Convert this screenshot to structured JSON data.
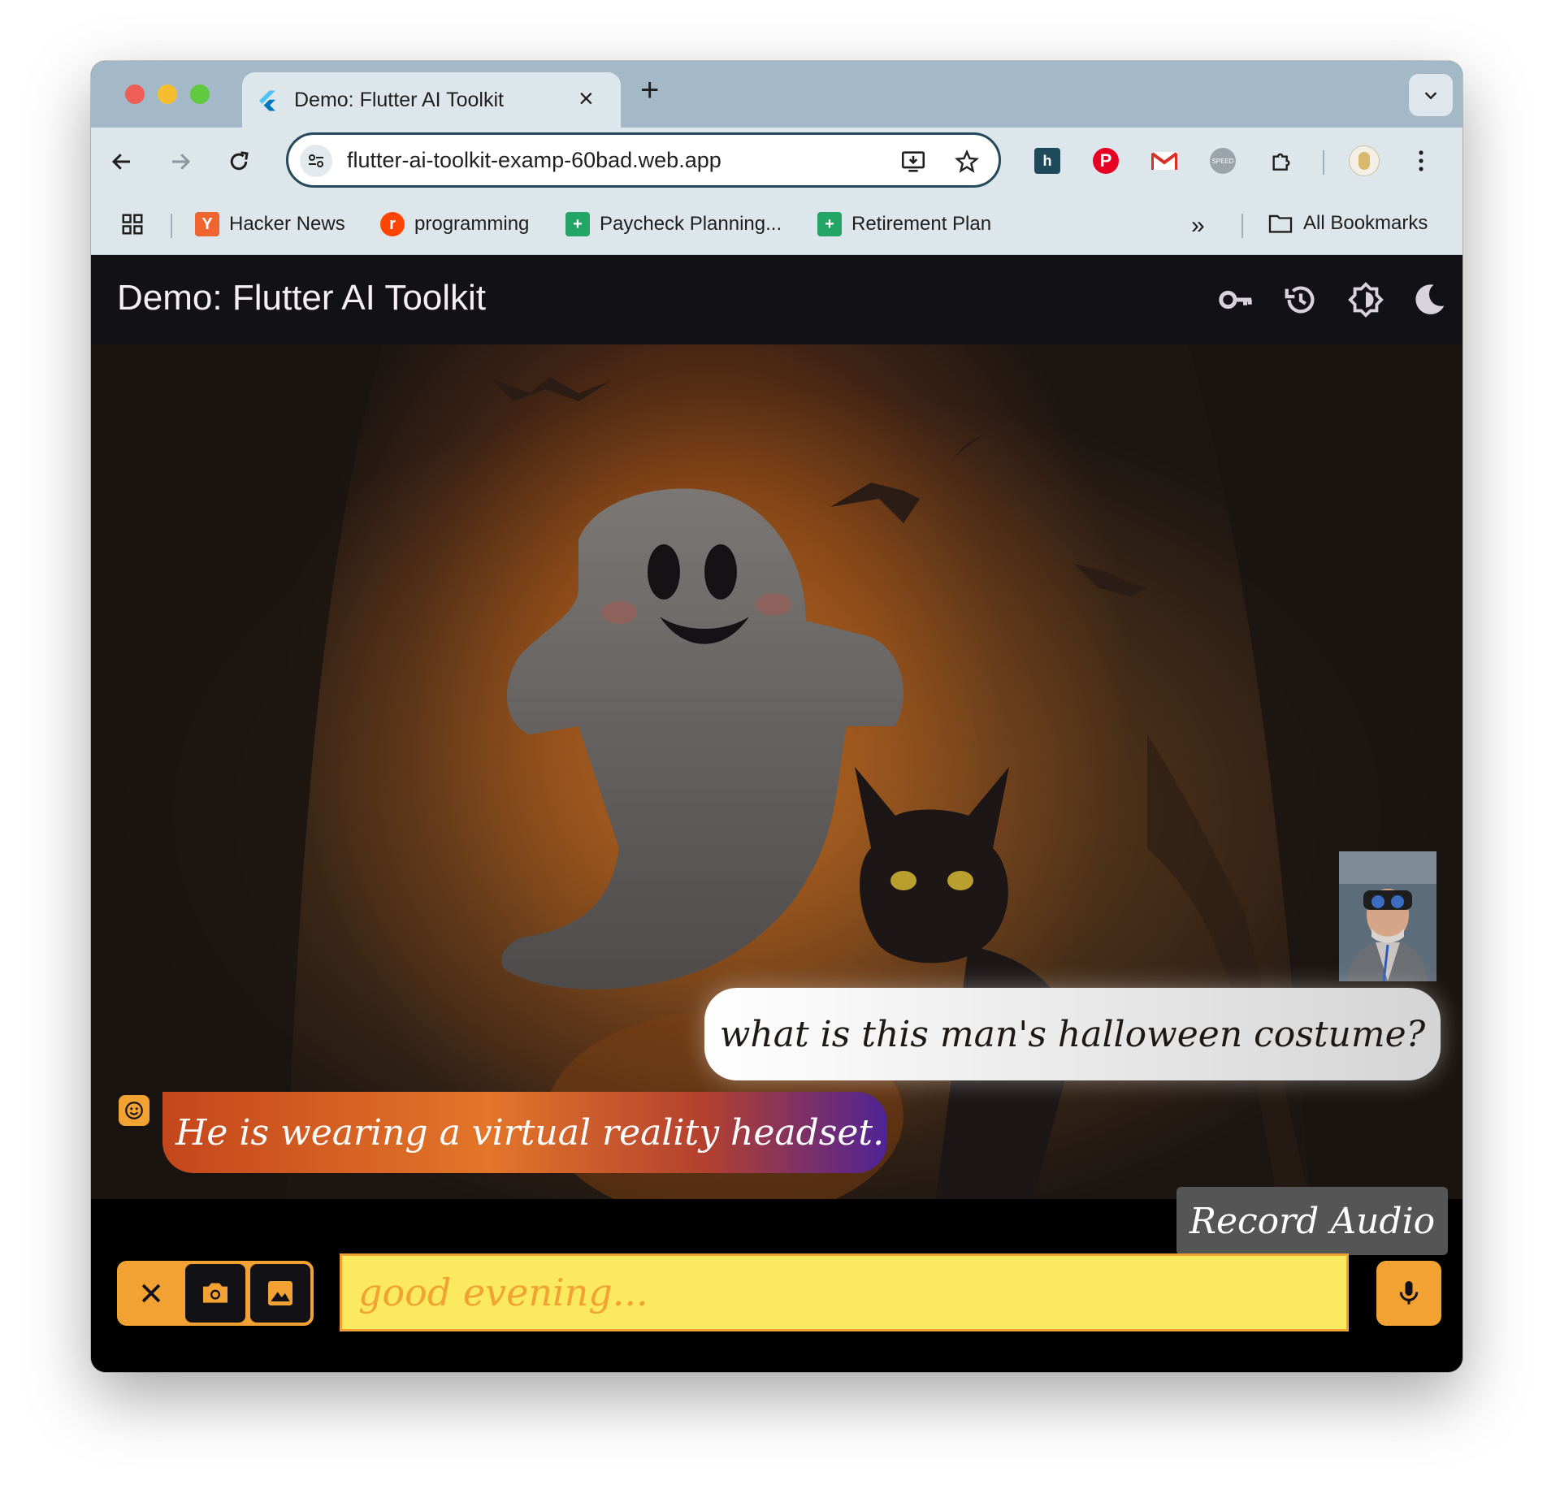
{
  "browser": {
    "tab_title": "Demo: Flutter AI Toolkit",
    "url": "flutter-ai-toolkit-examp-60bad.web.app",
    "bookmarks": [
      {
        "label": "Hacker News",
        "icon": "hacker-news-icon"
      },
      {
        "label": "programming",
        "icon": "reddit-icon"
      },
      {
        "label": "Paycheck Planning...",
        "icon": "sheets-icon"
      },
      {
        "label": "Retirement Plan",
        "icon": "sheets-icon"
      }
    ],
    "all_bookmarks_label": "All Bookmarks"
  },
  "app": {
    "title": "Demo: Flutter AI Toolkit",
    "actions": [
      "key-icon",
      "history-icon",
      "brightness-icon",
      "dark-mode-icon"
    ]
  },
  "chat": {
    "user_message": "what is this man's halloween costume?",
    "llm_message": "He is wearing a virtual reality headset."
  },
  "input": {
    "placeholder": "good evening...",
    "record_tooltip": "Record Audio"
  },
  "colors": {
    "accent_orange": "#f1a232",
    "prompt_yellow": "#fbe960",
    "appbar": "#121116",
    "user_bubble_start": "#ffffff",
    "llm_bubble_end": "#4f2496"
  }
}
